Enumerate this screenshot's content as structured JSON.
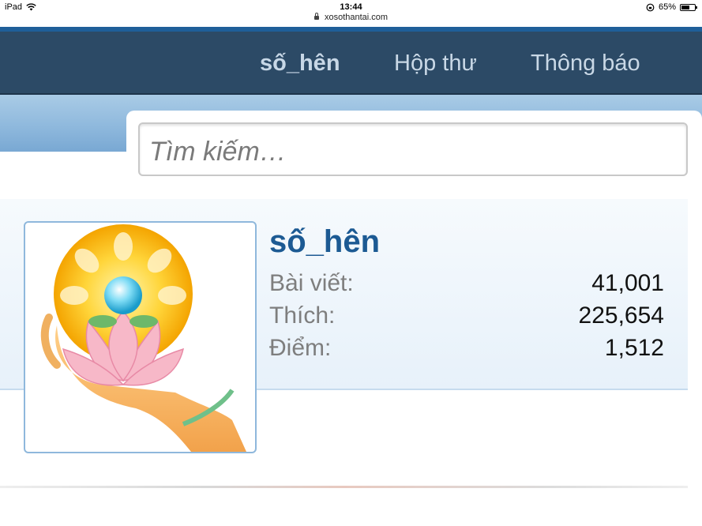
{
  "status_bar": {
    "device": "iPad",
    "time": "13:44",
    "battery": "65%",
    "battery_level": 0.65,
    "icons": [
      "wifi-icon",
      "rotation-lock-icon",
      "battery-icon"
    ]
  },
  "browser": {
    "url": "xosothantai.com"
  },
  "nav": {
    "user_label": "số_hên",
    "inbox_label": "Hộp thư",
    "alerts_label": "Thông báo"
  },
  "search": {
    "placeholder": "Tìm kiếm…"
  },
  "profile": {
    "username": "số_hên",
    "stats": [
      {
        "label": "Bài viết:",
        "value": "41,001"
      },
      {
        "label": "Thích:",
        "value": "225,654"
      },
      {
        "label": "Điểm:",
        "value": "1,512"
      }
    ]
  },
  "colors": {
    "nav_bg": "#2c4a66",
    "accent_blue": "#1c5a93",
    "band_blue": "#8fb9dd"
  }
}
